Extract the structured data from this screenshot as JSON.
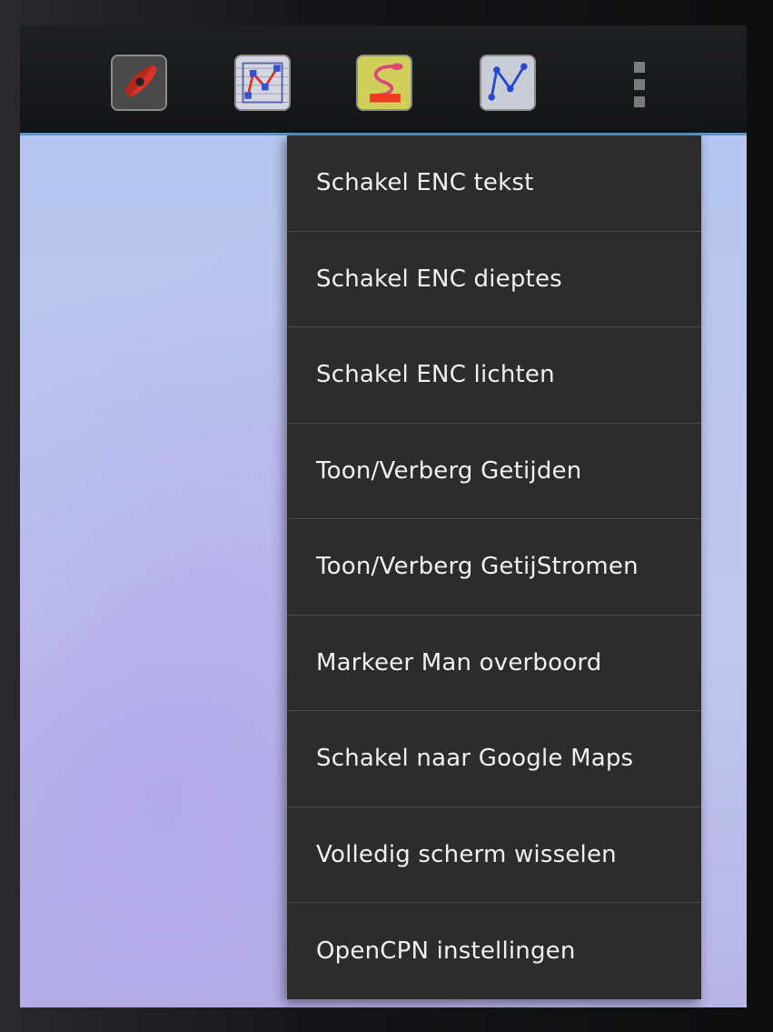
{
  "toolbar": {
    "buttons": [
      {
        "icon": "boat-icon",
        "accent": "#d8332a"
      },
      {
        "icon": "route-icon",
        "accent": "#3a4fc8"
      },
      {
        "icon": "track-icon",
        "accent": "#e0457a"
      },
      {
        "icon": "waypoints-icon",
        "accent": "#2546d0"
      }
    ],
    "overflow_icon": "more-vert-icon"
  },
  "menu": {
    "items": [
      "Schakel ENC tekst",
      "Schakel ENC dieptes",
      "Schakel ENC lichten",
      "Toon/Verberg Getijden",
      "Toon/Verberg GetijStromen",
      "Markeer Man overboord",
      "Schakel naar Google Maps",
      "Volledig scherm wisselen",
      "OpenCPN instellingen"
    ]
  },
  "colors": {
    "toolbar_bg": "#1a1b1d",
    "toolbar_border": "#5b96c6",
    "menu_bg": "#2c2c2c",
    "menu_text": "#f0f0f0",
    "chart_bg": "#b7c7ea"
  }
}
